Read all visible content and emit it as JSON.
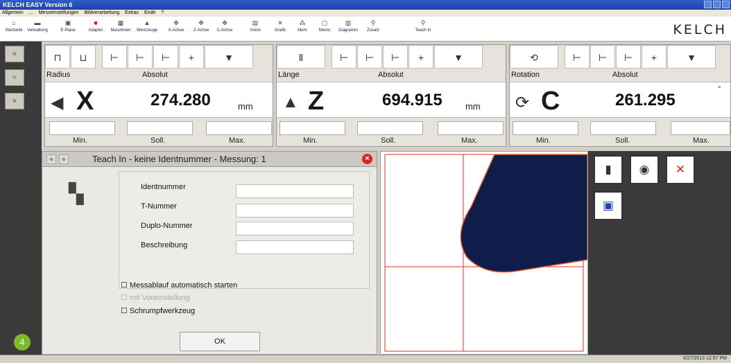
{
  "window": {
    "title": "KELCH EASY Version 6"
  },
  "menu": [
    "Allgemein",
    "...",
    "Messeinstellungen",
    "Bildverarbeitung",
    "Extras",
    "Ende",
    "?"
  ],
  "toolbar": {
    "items": [
      {
        "label": "Startseite",
        "icon": "home-icon"
      },
      {
        "label": "Verwaltung",
        "icon": "folder-icon"
      },
      {
        "label": "E-Plane",
        "icon": "plane-icon"
      },
      {
        "label": "Adapter",
        "icon": "adapter-icon"
      },
      {
        "label": "Maschinen",
        "icon": "machine-icon"
      },
      {
        "label": "Werkzeuge",
        "icon": "tool-icon"
      },
      {
        "label": "X-Achse",
        "icon": "axis-icon"
      },
      {
        "label": "Z-Achse",
        "icon": "axis-icon"
      },
      {
        "label": "C-Achse",
        "icon": "axis-icon"
      },
      {
        "label": "Vision",
        "icon": "vision-icon"
      },
      {
        "label": "Grafik",
        "icon": "graphic-icon"
      },
      {
        "label": "Mehr",
        "icon": "more-icon"
      },
      {
        "label": "Memo",
        "icon": "memo-icon"
      },
      {
        "label": "Diagramm",
        "icon": "diagram-icon"
      },
      {
        "label": "Zusatz",
        "icon": "extra-icon"
      },
      {
        "label": "Teach In",
        "icon": "teach-in-icon"
      }
    ],
    "brand": "KELCH"
  },
  "panels": [
    {
      "label": "Radius",
      "mode": "Absolut",
      "axis": "X",
      "value": "274.280",
      "unit": "mm",
      "icon": "arrow-left-icon",
      "min": "Min.",
      "soll": "Soll.",
      "max": "Max."
    },
    {
      "label": "Länge",
      "mode": "Absolut",
      "axis": "Z",
      "value": "694.915",
      "unit": "mm",
      "icon": "arrow-up-icon",
      "min": "Min.",
      "soll": "Soll.",
      "max": "Max."
    },
    {
      "label": "Rotation",
      "mode": "Absolut",
      "axis": "C",
      "value": "261.295",
      "unit": "°",
      "icon": "rotate-icon",
      "min": "Min.",
      "soll": "Soll.",
      "max": "Max."
    }
  ],
  "dialog": {
    "title": "Teach In - keine Identnummer - Messung: 1",
    "fields": [
      {
        "label": "Identnummer",
        "value": ""
      },
      {
        "label": "T-Nummer",
        "value": ""
      },
      {
        "label": "Duplo-Nummer",
        "value": ""
      },
      {
        "label": "Beschreibung",
        "value": ""
      }
    ],
    "options": [
      {
        "label": "Messablauf automatisch starten",
        "enabled": true
      },
      {
        "label": "mit Voreinstellung",
        "enabled": false
      },
      {
        "label": "Schrumpfwerkzeug",
        "enabled": true
      }
    ],
    "ok": "OK"
  },
  "badge": "4",
  "status": {
    "clock": "6/27/2013 12:57 PM"
  },
  "colors": {
    "title": "#1c43a8",
    "profile": "#0f1d4a",
    "crosshair": "#e03020",
    "badge": "#7dbb2c"
  }
}
